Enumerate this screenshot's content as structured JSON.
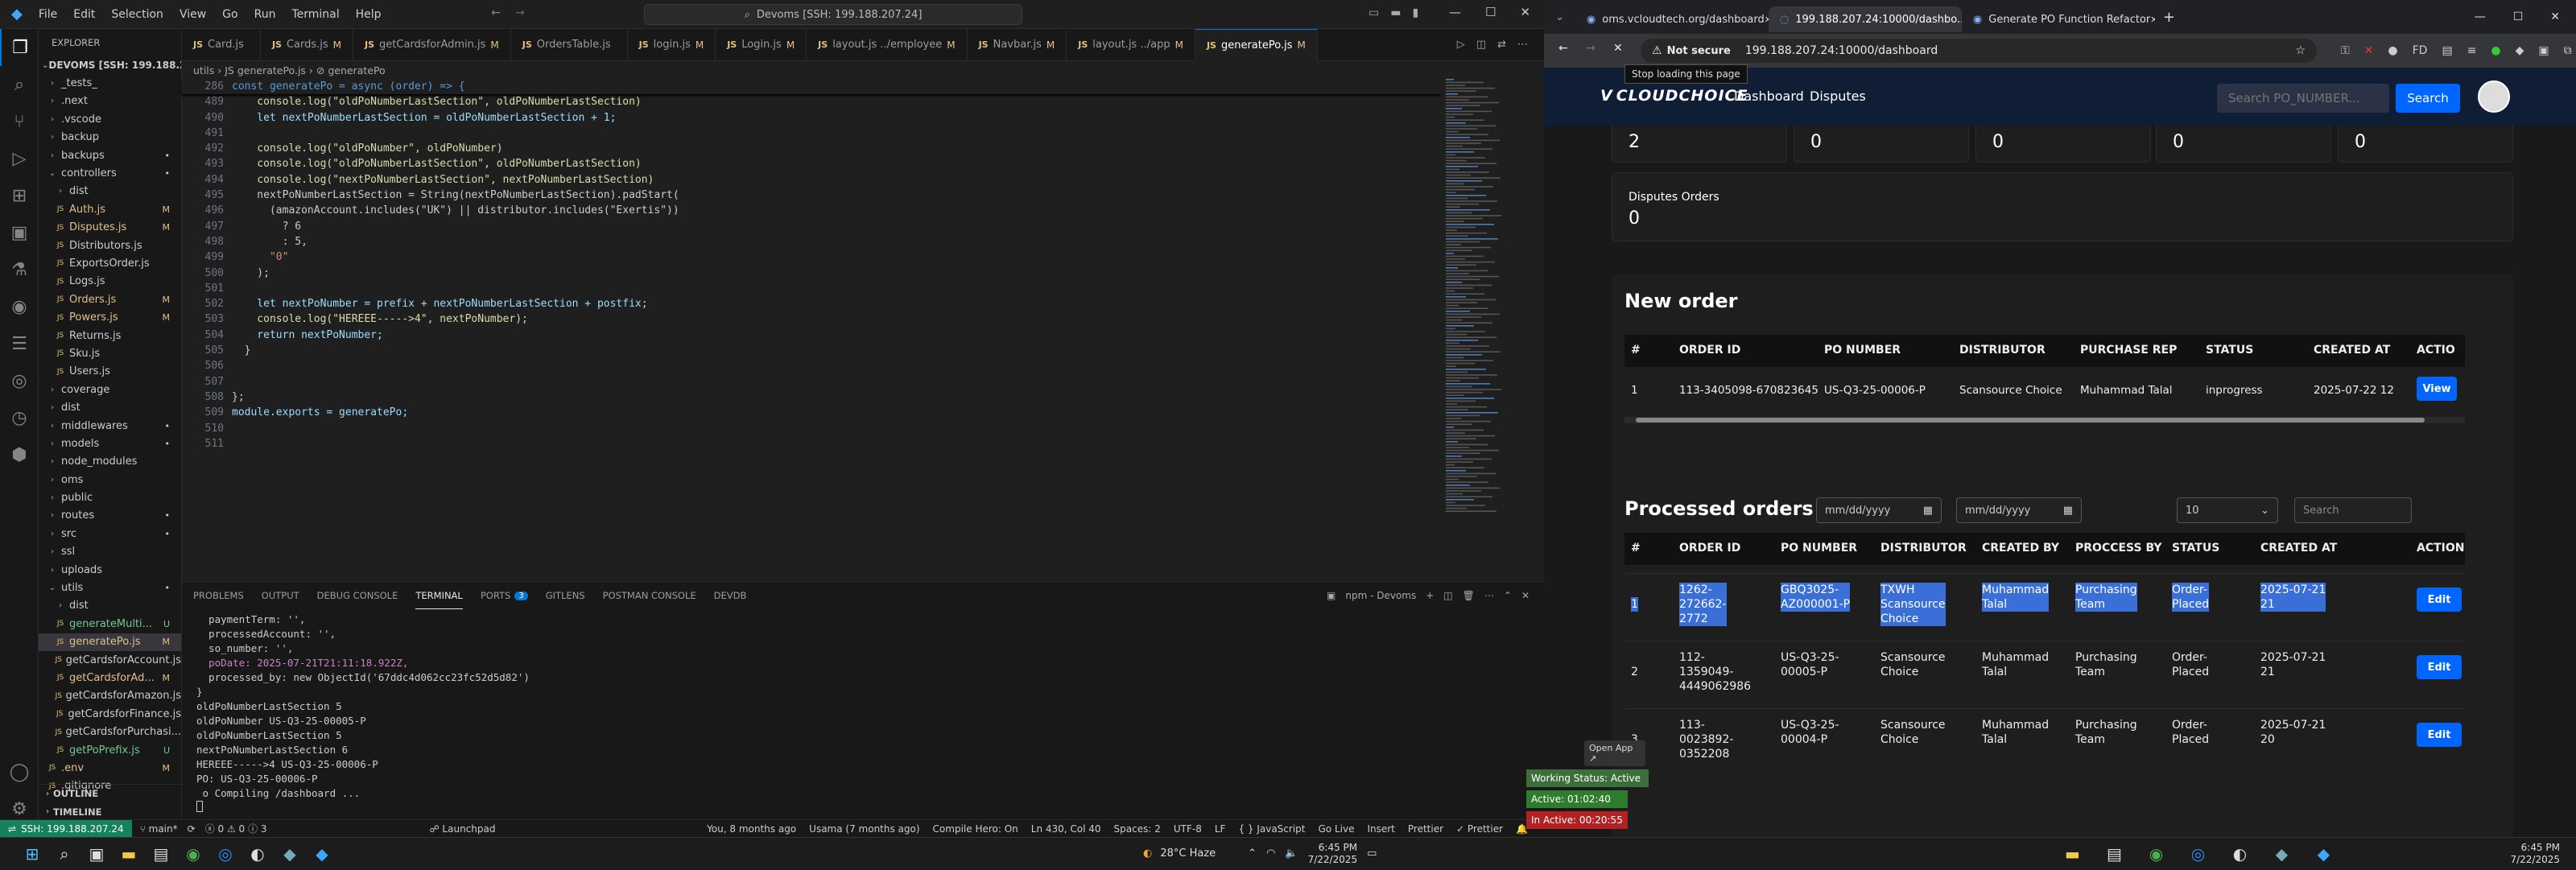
{
  "vscode": {
    "menu": [
      "File",
      "Edit",
      "Selection",
      "View",
      "Go",
      "Run",
      "Terminal",
      "Help"
    ],
    "command_center": "Devoms [SSH: 199.188.207.24]",
    "tabs": [
      {
        "label": "Card.js",
        "mod": ""
      },
      {
        "label": "Cards.js",
        "mod": "M"
      },
      {
        "label": "getCardsforAdmin.js",
        "mod": "M"
      },
      {
        "label": "OrdersTable.js",
        "mod": ""
      },
      {
        "label": "login.js",
        "mod": "M"
      },
      {
        "label": "Login.js",
        "mod": "M"
      },
      {
        "label": "layout.js ../employee",
        "mod": "M"
      },
      {
        "label": "Navbar.js",
        "mod": "M"
      },
      {
        "label": "layout.js ../app",
        "mod": "M"
      },
      {
        "label": "generatePo.js",
        "mod": "M"
      }
    ],
    "breadcrumb": "utils › JS generatePo.js › ⊘ generatePo",
    "explorer_title": "EXPLORER",
    "root_label": "DEVOMS [SSH: 199.188.20...",
    "tree": [
      {
        "label": "_tests_",
        "depth": 1,
        "type": "folder",
        "badge": ""
      },
      {
        "label": ".next",
        "depth": 1,
        "type": "folder",
        "badge": ""
      },
      {
        "label": ".vscode",
        "depth": 1,
        "type": "folder",
        "badge": ""
      },
      {
        "label": "backup",
        "depth": 1,
        "type": "folder",
        "badge": ""
      },
      {
        "label": "backups",
        "depth": 1,
        "type": "folder",
        "badge": "•"
      },
      {
        "label": "controllers",
        "depth": 1,
        "type": "folder-open",
        "badge": "•"
      },
      {
        "label": "dist",
        "depth": 2,
        "type": "folder",
        "badge": ""
      },
      {
        "label": "Auth.js",
        "depth": 2,
        "type": "file",
        "badge": "M"
      },
      {
        "label": "Disputes.js",
        "depth": 2,
        "type": "file",
        "badge": "M"
      },
      {
        "label": "Distributors.js",
        "depth": 2,
        "type": "file",
        "badge": ""
      },
      {
        "label": "ExportsOrder.js",
        "depth": 2,
        "type": "file",
        "badge": ""
      },
      {
        "label": "Logs.js",
        "depth": 2,
        "type": "file",
        "badge": ""
      },
      {
        "label": "Orders.js",
        "depth": 2,
        "type": "file",
        "badge": "M"
      },
      {
        "label": "Powers.js",
        "depth": 2,
        "type": "file",
        "badge": "M"
      },
      {
        "label": "Returns.js",
        "depth": 2,
        "type": "file",
        "badge": ""
      },
      {
        "label": "Sku.js",
        "depth": 2,
        "type": "file",
        "badge": ""
      },
      {
        "label": "Users.js",
        "depth": 2,
        "type": "file",
        "badge": ""
      },
      {
        "label": "coverage",
        "depth": 1,
        "type": "folder",
        "badge": ""
      },
      {
        "label": "dist",
        "depth": 1,
        "type": "folder",
        "badge": ""
      },
      {
        "label": "middlewares",
        "depth": 1,
        "type": "folder",
        "badge": "•"
      },
      {
        "label": "models",
        "depth": 1,
        "type": "folder",
        "badge": "•"
      },
      {
        "label": "node_modules",
        "depth": 1,
        "type": "folder",
        "badge": ""
      },
      {
        "label": "oms",
        "depth": 1,
        "type": "folder",
        "badge": ""
      },
      {
        "label": "public",
        "depth": 1,
        "type": "folder",
        "badge": ""
      },
      {
        "label": "routes",
        "depth": 1,
        "type": "folder",
        "badge": "•"
      },
      {
        "label": "src",
        "depth": 1,
        "type": "folder",
        "badge": "•"
      },
      {
        "label": "ssl",
        "depth": 1,
        "type": "folder",
        "badge": ""
      },
      {
        "label": "uploads",
        "depth": 1,
        "type": "folder",
        "badge": ""
      },
      {
        "label": "utils",
        "depth": 1,
        "type": "folder-open",
        "badge": "•"
      },
      {
        "label": "dist",
        "depth": 2,
        "type": "folder",
        "badge": ""
      },
      {
        "label": "generateMulti...",
        "depth": 2,
        "type": "file",
        "badge": "U"
      },
      {
        "label": "generatePo.js",
        "depth": 2,
        "type": "file",
        "badge": "M",
        "selected": true
      },
      {
        "label": "getCardsforAccount.js",
        "depth": 2,
        "type": "file",
        "badge": ""
      },
      {
        "label": "getCardsforAd...",
        "depth": 2,
        "type": "file",
        "badge": "M"
      },
      {
        "label": "getCardsforAmazon.js",
        "depth": 2,
        "type": "file",
        "badge": ""
      },
      {
        "label": "getCardsforFinance.js",
        "depth": 2,
        "type": "file",
        "badge": ""
      },
      {
        "label": "getCardsforPurchasi...",
        "depth": 2,
        "type": "file",
        "badge": ""
      },
      {
        "label": "getPoPrefix.js",
        "depth": 2,
        "type": "file",
        "badge": "U"
      },
      {
        "label": ".env",
        "depth": 1,
        "type": "file",
        "badge": "M"
      },
      {
        "label": ".gitignore",
        "depth": 1,
        "type": "file",
        "badge": ""
      }
    ],
    "outline_label": "OUTLINE",
    "timeline_label": "TIMELINE",
    "sticky_line": {
      "n": "286",
      "text": "const generatePo = async (order) => {"
    },
    "code_lines": [
      {
        "n": "489",
        "text": "    console.log(\"oldPoNumberLastSection\", oldPoNumberLastSection)"
      },
      {
        "n": "490",
        "text": "    let nextPoNumberLastSection = oldPoNumberLastSection + 1;"
      },
      {
        "n": "491",
        "text": ""
      },
      {
        "n": "492",
        "text": "    console.log(\"oldPoNumber\", oldPoNumber)"
      },
      {
        "n": "493",
        "text": "    console.log(\"oldPoNumberLastSection\", oldPoNumberLastSection)"
      },
      {
        "n": "494",
        "text": "    console.log(\"nextPoNumberLastSection\", nextPoNumberLastSection)"
      },
      {
        "n": "495",
        "text": "    nextPoNumberLastSection = String(nextPoNumberLastSection).padStart("
      },
      {
        "n": "496",
        "text": "      (amazonAccount.includes(\"UK\") || distributor.includes(\"Exertis\"))"
      },
      {
        "n": "497",
        "text": "        ? 6"
      },
      {
        "n": "498",
        "text": "        : 5,"
      },
      {
        "n": "499",
        "text": "      \"0\""
      },
      {
        "n": "500",
        "text": "    );"
      },
      {
        "n": "501",
        "text": ""
      },
      {
        "n": "502",
        "text": "    let nextPoNumber = prefix + nextPoNumberLastSection + postfix;"
      },
      {
        "n": "503",
        "text": "    console.log(\"HEREEE----->4\", nextPoNumber);"
      },
      {
        "n": "504",
        "text": "    return nextPoNumber;"
      },
      {
        "n": "505",
        "text": "  }"
      },
      {
        "n": "506",
        "text": ""
      },
      {
        "n": "507",
        "text": ""
      },
      {
        "n": "508",
        "text": "};"
      },
      {
        "n": "509",
        "text": "module.exports = generatePo;"
      },
      {
        "n": "510",
        "text": ""
      },
      {
        "n": "511",
        "text": ""
      }
    ],
    "panel_tabs": [
      "PROBLEMS",
      "OUTPUT",
      "DEBUG CONSOLE",
      "TERMINAL",
      "PORTS",
      "GITLENS",
      "POSTMAN CONSOLE",
      "DEVDB"
    ],
    "ports_badge": "3",
    "terminal_title": "npm - Devoms",
    "terminal_lines": [
      "  paymentTerm: '',",
      "  processedAccount: '',",
      "  so_number: '',",
      "  poDate: 2025-07-21T21:11:18.922Z,",
      "  processed_by: new ObjectId('67ddc4d062cc23fc52d5d82')",
      "}",
      "oldPoNumberLastSection 5",
      "oldPoNumber US-Q3-25-00005-P",
      "oldPoNumberLastSection 5",
      "nextPoNumberLastSection 6",
      "HEREEE----->4 US-Q3-25-00006-P",
      "PO: US-Q3-25-00006-P",
      " o Compiling /dashboard ..."
    ],
    "status_left": {
      "remote": "SSH: 199.188.207.24",
      "branch": "main*",
      "errors": "0",
      "warnings": "0",
      "info": "3",
      "launchpad": "Launchpad"
    },
    "status_right": {
      "blame": "You, 8 months ago",
      "author": "Usama (7 months ago)",
      "compile": "Compile Hero: On",
      "position": "Ln 430, Col 40",
      "spaces": "Spaces: 2",
      "encoding": "UTF-8",
      "eol": "LF",
      "language": "{ } JavaScript",
      "golive": "Go Live",
      "insert": "Insert",
      "prettier": "Prettier",
      "prettier2": "✓ Prettier"
    }
  },
  "chrome": {
    "tabs": [
      {
        "label": "oms.vcloudtech.org/dashboard"
      },
      {
        "label": "199.188.207.24:10000/dashbo..."
      },
      {
        "label": "Generate PO Function Refactor"
      }
    ],
    "not_secure": "Not secure",
    "url": "199.188.207.24:10000/dashboard",
    "tooltip": "Stop loading this page"
  },
  "app": {
    "logo": "CLOUDCHOICE",
    "nav": [
      "Dashboard",
      "Disputes"
    ],
    "search_placeholder": "Search PO_NUMBER...",
    "search_button": "Search",
    "stat_values": [
      "2",
      "0",
      "0",
      "0",
      "0"
    ],
    "disputes_card": {
      "label": "Disputes Orders",
      "value": "0"
    },
    "new_order": {
      "title": "New order",
      "headers": [
        "#",
        "ORDER ID",
        "PO NUMBER",
        "DISTRIBUTOR",
        "PURCHASE REP",
        "STATUS",
        "CREATED AT",
        "ACTIO"
      ],
      "rows": [
        {
          "num": "1",
          "order_id": "113-3405098-670823645",
          "po": "US-Q3-25-00006-P",
          "distributor": "Scansource Choice",
          "rep": "Muhammad Talal",
          "status": "inprogress",
          "created": "2025-07-22 12",
          "action": "View"
        }
      ]
    },
    "processed": {
      "title": "Processed orders",
      "date_placeholder": "mm/dd/yyyy",
      "page_size": "10",
      "search_placeholder": "Search",
      "headers": [
        "#",
        "ORDER ID",
        "PO NUMBER",
        "DISTRIBUTOR",
        "CREATED BY",
        "PROCCESS BY",
        "STATUS",
        "CREATED AT",
        "ACTION"
      ],
      "rows": [
        {
          "num": "1",
          "order_id": [
            "1262-",
            "272662-",
            "2772"
          ],
          "po": [
            "GBQ3025-",
            "AZ000001-P"
          ],
          "distributor": [
            "TXWH",
            "Scansource",
            "Choice"
          ],
          "created_by": [
            "Muhammad",
            "Talal"
          ],
          "process_by": [
            "Purchasing",
            "Team"
          ],
          "status": [
            "Order-",
            "Placed"
          ],
          "created": [
            "2025-07-21",
            "21"
          ],
          "action": "Edit"
        },
        {
          "num": "2",
          "order_id": [
            "112-",
            "1359049-",
            "4449062986"
          ],
          "po": [
            "US-Q3-25-",
            "00005-P"
          ],
          "distributor": [
            "Scansource",
            "Choice"
          ],
          "created_by": [
            "Muhammad",
            "Talal"
          ],
          "process_by": [
            "Purchasing",
            "Team"
          ],
          "status": [
            "Order-",
            "Placed"
          ],
          "created": [
            "2025-07-21",
            "21"
          ],
          "action": "Edit"
        },
        {
          "num": "3",
          "order_id": [
            "113-",
            "0023892-",
            "0352208"
          ],
          "po": [
            "US-Q3-25-",
            "00004-P"
          ],
          "distributor": [
            "Scansource",
            "Choice"
          ],
          "created_by": [
            "Muhammad",
            "Talal"
          ],
          "process_by": [
            "Purchasing",
            "Team"
          ],
          "status": [
            "Order-",
            "Placed"
          ],
          "created": [
            "2025-07-21",
            "20"
          ],
          "action": "Edit"
        }
      ]
    }
  },
  "widget": {
    "open_app": "Open App ↗",
    "working": "Working Status: Active",
    "active": "Active: 01:02:40",
    "inactive": "In Active: 00:20:55"
  },
  "taskbar": {
    "weather": "28°C  Haze",
    "time": "6:45 PM",
    "date": "7/22/2025",
    "time2": "6:45 PM",
    "date2": "7/22/2025"
  },
  "colors": {
    "accent": "#0078d4",
    "remote": "#16825d",
    "navbar": "#0f1d35",
    "blue_button": "#0066ff",
    "selection": "#3a6fd8",
    "modified": "#e2c08d"
  }
}
